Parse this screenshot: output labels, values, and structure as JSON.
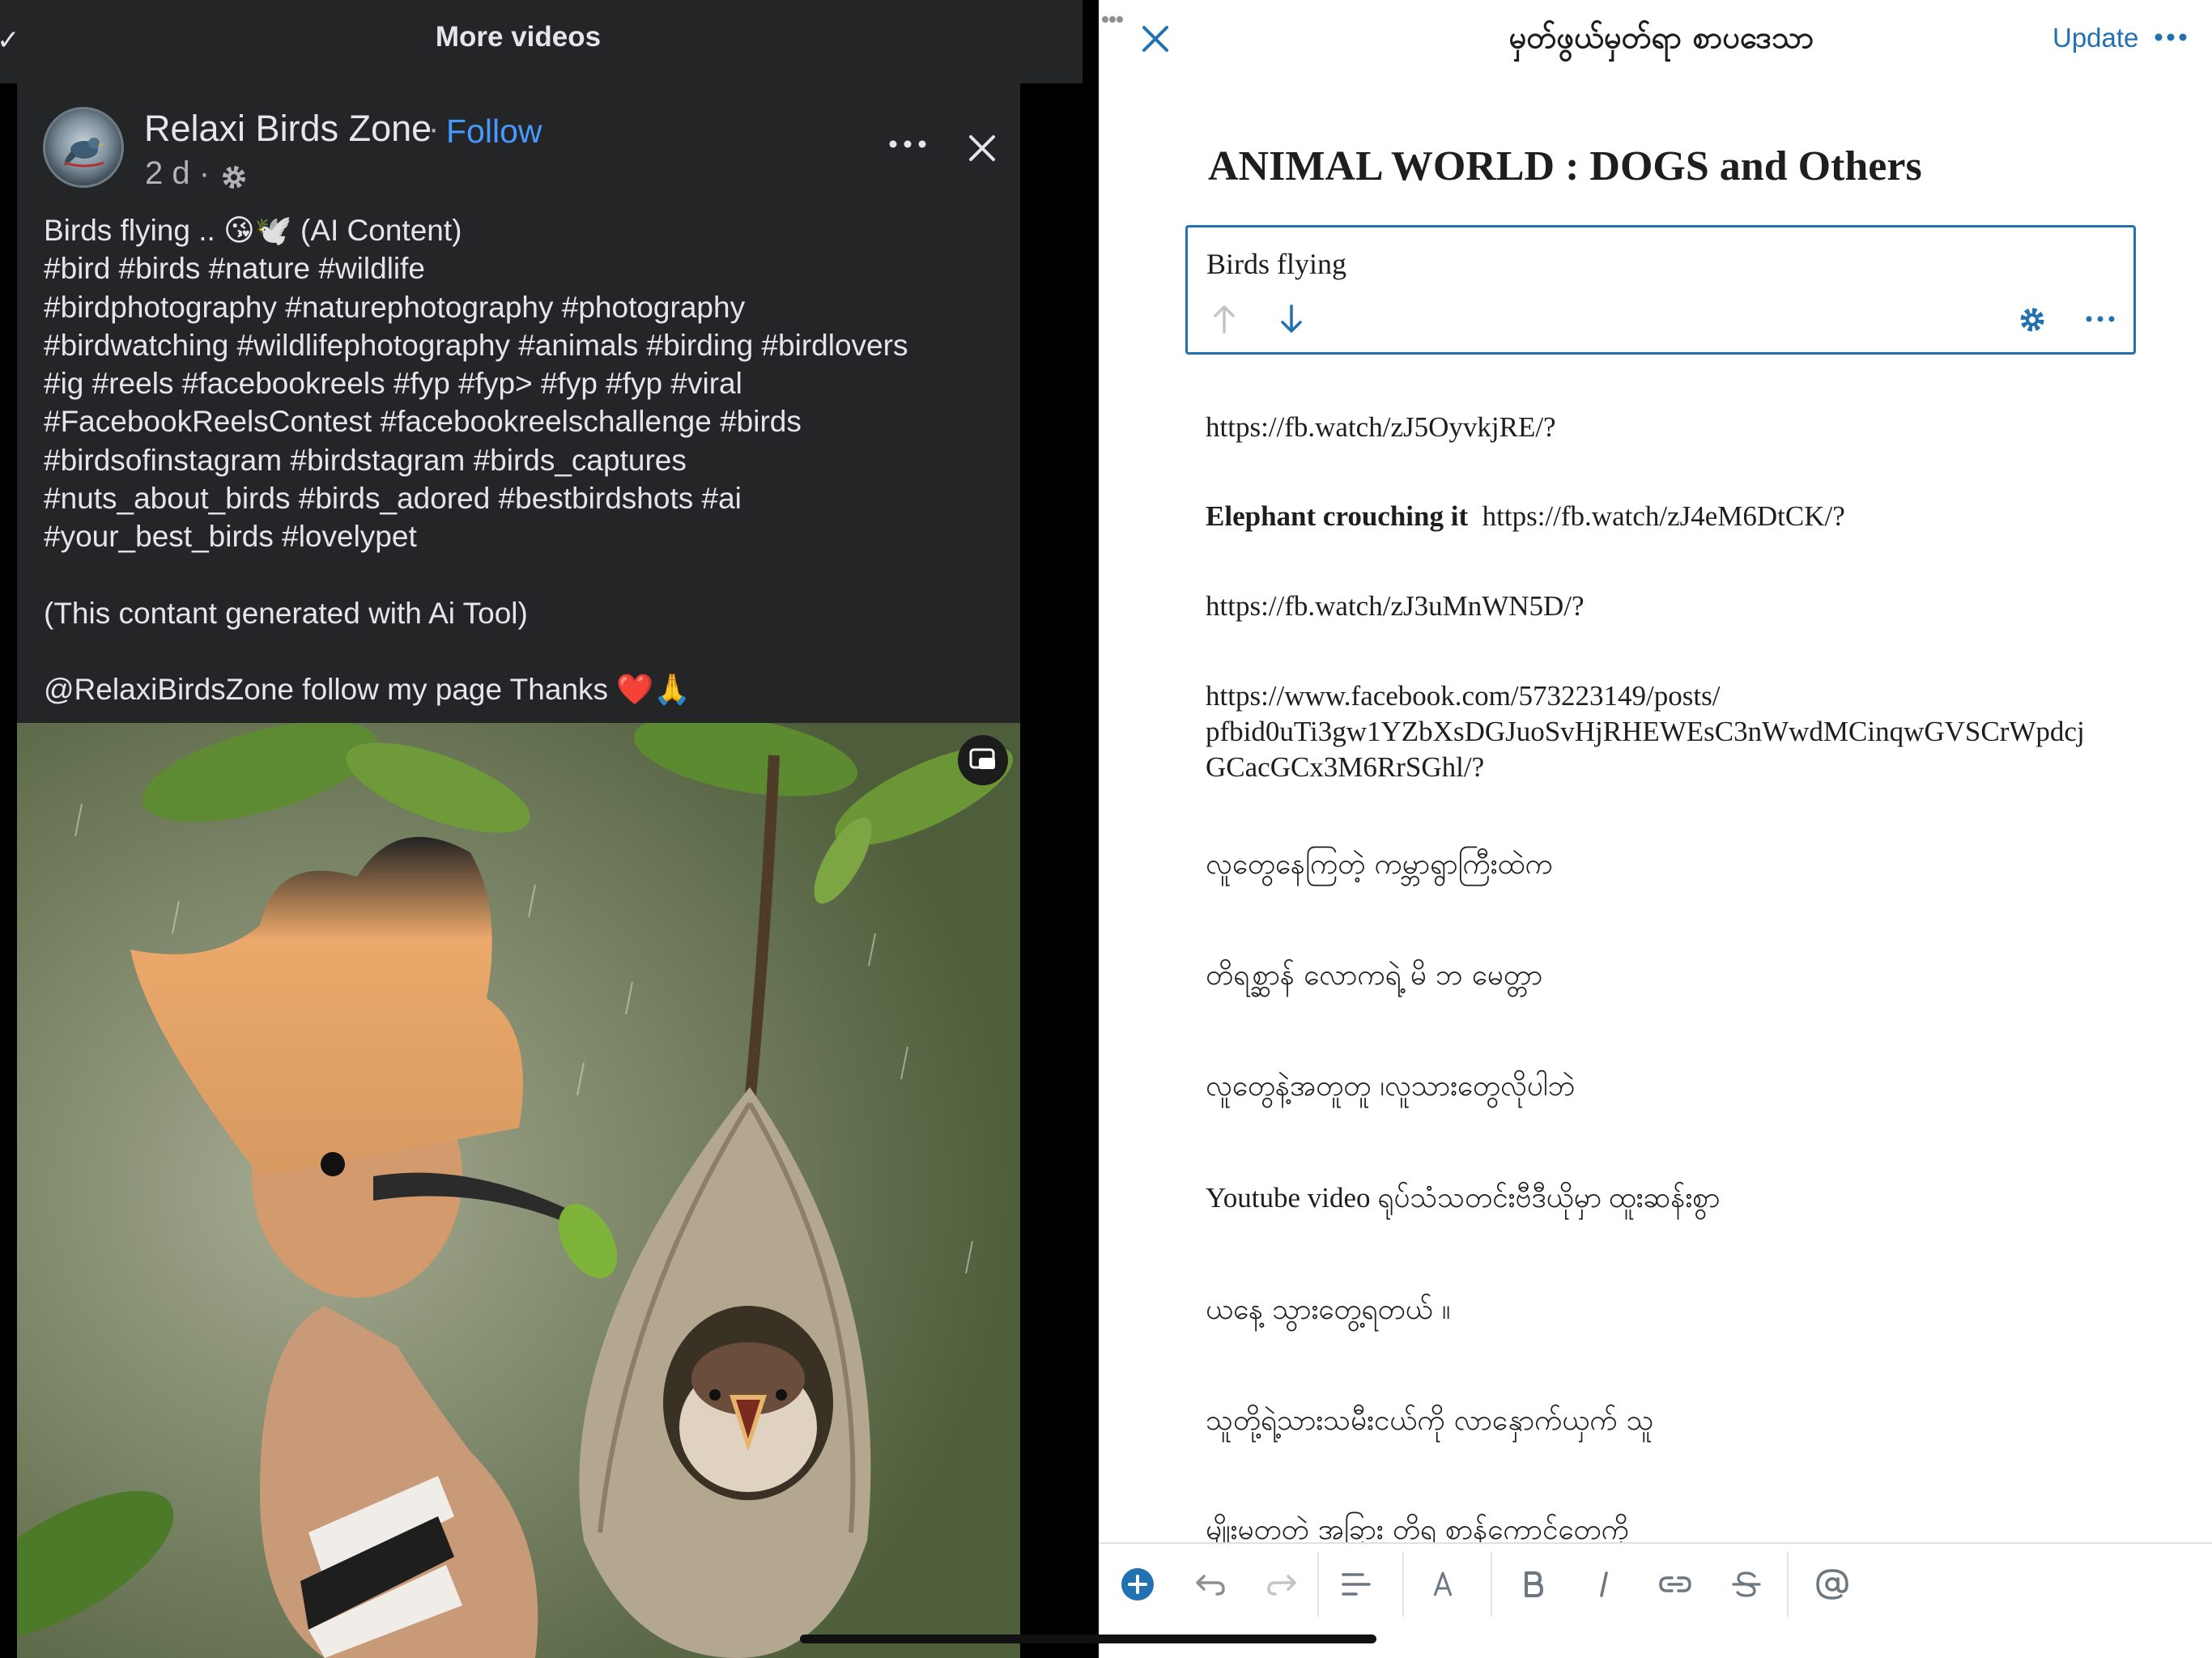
{
  "facebook": {
    "top_bar_title": "More videos",
    "page_name": "Relaxi Birds Zone",
    "follow_label": "Follow",
    "separator_dot": "·",
    "post_time": "2 d ·",
    "caption_lines": [
      "Birds flying .. 😘🕊️ (AI Content)",
      "#bird #birds #nature #wildlife",
      "#birdphotography #naturephotography #photography",
      "#birdwatching #wildlifephotography #animals #birding #birdlovers",
      "#ig #reels #facebookreels #fyp #fyp> #fyp #fyp #viral",
      "#FacebookReelsContest #facebookreelschallenge #birds",
      "#birdsofinstagram #birdstagram #birds_captures",
      "#nuts_about_birds #birds_adored #bestbirdshots #ai",
      "#your_best_birds #lovelypet"
    ],
    "caption_note": "(This contant generated with Ai Tool)",
    "caption_footer": "@RelaxiBirdsZone follow my page Thanks ❤️🙏"
  },
  "editor": {
    "header_title": "မှတ်ဖွယ်မှတ်ရာ စာပဒေသာ",
    "update_label": "Update",
    "doc_title": "ANIMAL WORLD : DOGS and Others",
    "selected_block_text": "Birds flying",
    "paragraphs": [
      {
        "text": "https://fb.watch/zJ5OyvkjRE/?"
      },
      {
        "bold": "Elephant crouching it",
        "text": "https://fb.watch/zJ4eM6DtCK/?"
      },
      {
        "text": "https://fb.watch/zJ3uMnWN5D/?"
      },
      {
        "lines": [
          "https://www.facebook.com/573223149/posts/",
          "pfbid0uTi3gw1YZbXsDGJuoSvHjRHEWEsC3nWwdMCinqwGVSCrWpdcj",
          "GCacGCx3M6RrSGhl/?"
        ]
      },
      {
        "text": "လူတွေနေကြတဲ့ ကမ္ဘာရွာကြီးထဲက"
      },
      {
        "text": "တိရစ္ဆာန် လောကရဲ့ မိ ဘ မေတ္တာ"
      },
      {
        "text": "လူတွေနဲ့အတူတူ ၊လူသားတွေလိုပါဘဲ"
      },
      {
        "text": "Youtube video ရုပ်သံသတင်းဗီဒီယိုမှာ ထူးဆန်းစွာ"
      },
      {
        "text": "ယနေ့ သွားတွေ့ရတယ် ။"
      },
      {
        "text": "သူတို့ရဲ့သားသမီးငယ်ကို လာနှောက်ယှက် သူ"
      },
      {
        "text": "မျိုးမတတဲ အခြား တိရ စာန်ကောင်တေကို"
      }
    ],
    "toolbar_icons": [
      "add-block-icon",
      "undo-icon",
      "redo-icon",
      "list-view-icon",
      "text-color-icon",
      "bold-icon",
      "italic-icon",
      "link-icon",
      "strikethrough-icon",
      "mention-icon"
    ],
    "accent_color": "#2271b1"
  }
}
